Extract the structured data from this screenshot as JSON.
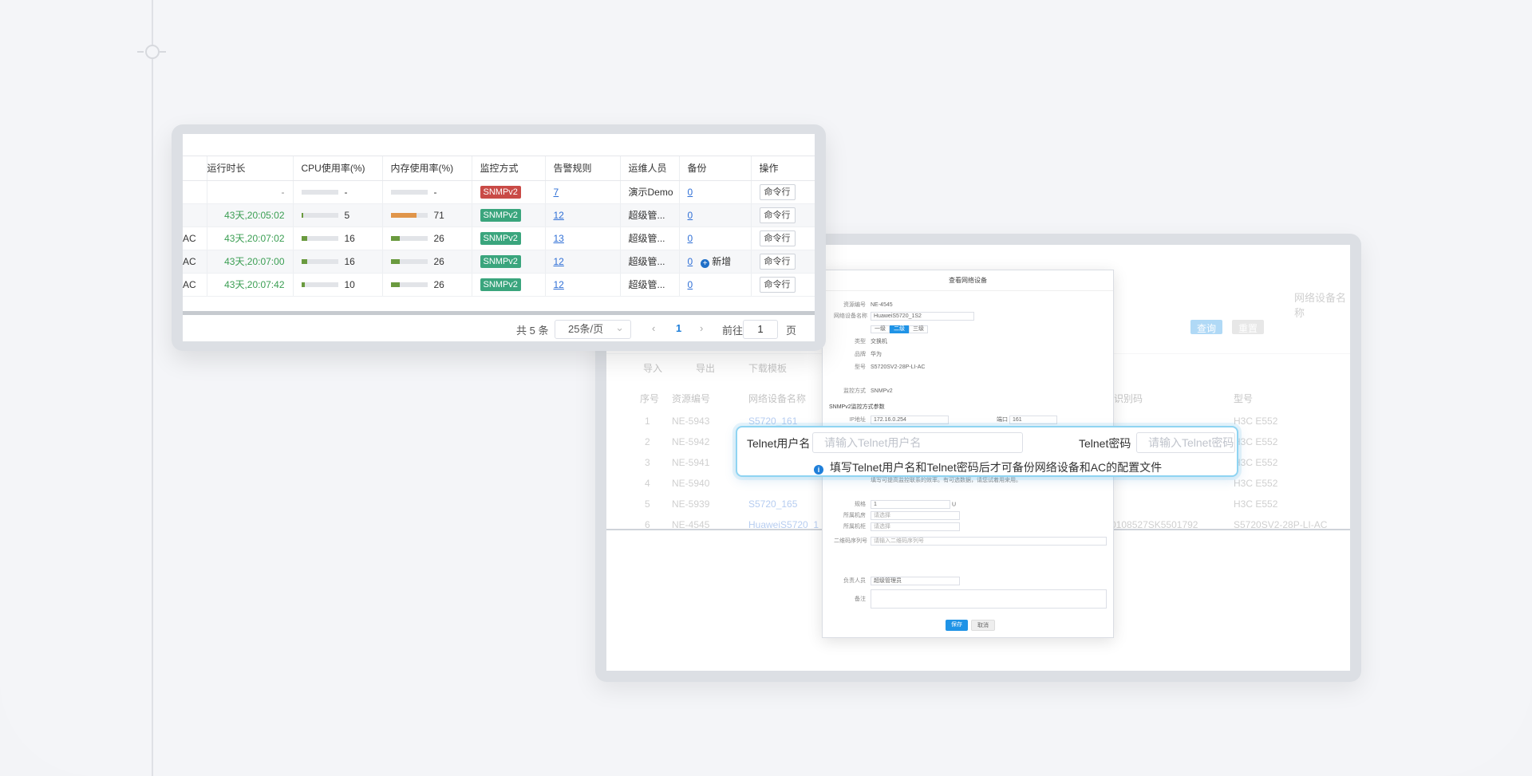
{
  "monitor_table": {
    "columns": [
      "运行时长",
      "CPU使用率(%)",
      "内存使用率(%)",
      "监控方式",
      "告警规则",
      "运维人员",
      "备份",
      "操作"
    ],
    "rows": [
      {
        "prefix": "",
        "uptime": "-",
        "cpu": "-",
        "cpu_pct": 0,
        "mem": "-",
        "mem_pct": 0,
        "monitor": "SNMPv2",
        "monitor_color": "#c94a46",
        "alarm": "7",
        "ops": "演示Demo",
        "backup": "0",
        "add": "",
        "action": "命令行"
      },
      {
        "prefix": "",
        "uptime": "43天,20:05:02",
        "cpu": "5",
        "cpu_pct": 5,
        "mem": "71",
        "mem_pct": 71,
        "monitor": "SNMPv2",
        "monitor_color": "#3aa57d",
        "alarm": "12",
        "ops": "超级管...",
        "backup": "0",
        "add": "",
        "action": "命令行"
      },
      {
        "prefix": "AC",
        "uptime": "43天,20:07:02",
        "cpu": "16",
        "cpu_pct": 16,
        "mem": "26",
        "mem_pct": 26,
        "monitor": "SNMPv2",
        "monitor_color": "#3aa57d",
        "alarm": "13",
        "ops": "超级管...",
        "backup": "0",
        "add": "",
        "action": "命令行"
      },
      {
        "prefix": "AC",
        "uptime": "43天,20:07:00",
        "cpu": "16",
        "cpu_pct": 16,
        "mem": "26",
        "mem_pct": 26,
        "monitor": "SNMPv2",
        "monitor_color": "#3aa57d",
        "alarm": "12",
        "ops": "超级管...",
        "backup": "0",
        "add": "新增",
        "action": "命令行"
      },
      {
        "prefix": "AC",
        "uptime": "43天,20:07:42",
        "cpu": "10",
        "cpu_pct": 10,
        "mem": "26",
        "mem_pct": 26,
        "monitor": "SNMPv2",
        "monitor_color": "#3aa57d",
        "alarm": "12",
        "ops": "超级管...",
        "backup": "0",
        "add": "",
        "action": "命令行"
      }
    ],
    "pager": {
      "total": "共 5 条",
      "page_size": "25条/页",
      "current": "1",
      "goto_label": "前往",
      "goto_value": "1",
      "page_suffix": "页"
    }
  },
  "back_window": {
    "search_label_1": "网络设备名称",
    "query_button": "查询",
    "reset_button": "重置",
    "toolbar": [
      "导入",
      "导出",
      "下载模板"
    ],
    "columns": [
      "序号",
      "资源编号",
      "网络设备名称",
      "唯一识别码",
      "型号"
    ],
    "rows": [
      {
        "no": "1",
        "id": "NE-5943",
        "name": "S5720_161",
        "uid": "",
        "model": "H3C E552"
      },
      {
        "no": "2",
        "id": "NE-5942",
        "name": "",
        "uid": "",
        "model": "H3C E552"
      },
      {
        "no": "3",
        "id": "NE-5941",
        "name": "",
        "uid": "",
        "model": "H3C E552"
      },
      {
        "no": "4",
        "id": "NE-5940",
        "name": "",
        "uid": "",
        "model": "H3C E552"
      },
      {
        "no": "5",
        "id": "NE-5939",
        "name": "S5720_165",
        "uid": "",
        "model": "H3C E552"
      },
      {
        "no": "6",
        "id": "NE-4545",
        "name": "HuaweiS5720_1",
        "uid": "2100108527SK5501792",
        "model": "S5720SV2-28P-LI-AC"
      }
    ]
  },
  "dialog": {
    "title": "查看网络设备",
    "fields": [
      {
        "label": "资源编号",
        "value": "NE-4545"
      },
      {
        "label": "网络设备名称",
        "value": "HuaweiS5720_1S2"
      },
      {
        "label": "类型",
        "value": "交换机"
      },
      {
        "label": "品牌",
        "value": "华为"
      },
      {
        "label": "型号",
        "value": "S5720SV2-28P-LI-AC"
      },
      {
        "label": "监控方式",
        "value": "SNMPv2"
      }
    ],
    "level_options": [
      "一级",
      "二级",
      "三级"
    ],
    "section_snmp": "SNMPv2监控方式参数",
    "ip_label": "IP地址",
    "ip_value": "172.16.0.254",
    "port_label": "端口",
    "port_value": "161",
    "note_text": "填写可提高监控联系的效率。有可选数据，请您试着用来用。",
    "height_label": "规格",
    "height_value": "1",
    "height_unit": "U",
    "room_label": "所属机房",
    "room_placeholder": "请选择",
    "cabinet_label": "所属机柜",
    "cabinet_placeholder": "请选择",
    "qr_label": "二维码序列号",
    "qr_placeholder": "请输入二维码序列号",
    "owner_label": "负责人员",
    "owner_value": "超级管理员",
    "remark_label": "备注",
    "save_button": "保存",
    "cancel_button": "取消"
  },
  "telnet": {
    "user_label": "Telnet用户名",
    "user_placeholder": "请输入Telnet用户名",
    "pwd_label": "Telnet密码",
    "pwd_placeholder": "请输入Telnet密码",
    "tip": "填写Telnet用户名和Telnet密码后才可备份网络设备和AC的配置文件"
  },
  "colors": {
    "accent": "#1f93e6",
    "success": "#3aa57d",
    "danger": "#c94a46",
    "bar_cpu": "#6a9a3f",
    "bar_mem_high": "#e0954a",
    "bar_mem": "#6a9a3f"
  }
}
